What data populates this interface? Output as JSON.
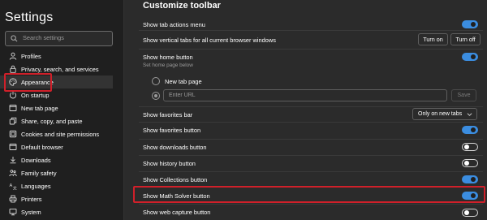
{
  "colors": {
    "sidebar_bg": "#1f1f1f",
    "content_bg": "#2b2b2b",
    "accent": "#3b8de0",
    "highlight": "#d0202a"
  },
  "sidebar": {
    "title": "Settings",
    "search": {
      "placeholder": "Search settings",
      "icon": "search-icon"
    },
    "items": [
      {
        "label": "Profiles",
        "icon": "profile-icon"
      },
      {
        "label": "Privacy, search, and services",
        "icon": "lock-icon"
      },
      {
        "label": "Appearance",
        "icon": "palette-icon",
        "selected": true
      },
      {
        "label": "On startup",
        "icon": "power-icon"
      },
      {
        "label": "New tab page",
        "icon": "new-tab-icon"
      },
      {
        "label": "Share, copy, and paste",
        "icon": "share-icon"
      },
      {
        "label": "Cookies and site permissions",
        "icon": "cookies-icon"
      },
      {
        "label": "Default browser",
        "icon": "browser-icon"
      },
      {
        "label": "Downloads",
        "icon": "download-icon"
      },
      {
        "label": "Family safety",
        "icon": "family-icon"
      },
      {
        "label": "Languages",
        "icon": "languages-icon"
      },
      {
        "label": "Printers",
        "icon": "printer-icon"
      },
      {
        "label": "System",
        "icon": "system-icon"
      }
    ]
  },
  "main": {
    "section_title": "Customize toolbar",
    "rows": {
      "tab_actions": {
        "label": "Show tab actions menu",
        "toggle": true
      },
      "vertical_tabs": {
        "label": "Show vertical tabs for all current browser windows",
        "turn_on": "Turn on",
        "turn_off": "Turn off"
      },
      "home_button": {
        "label": "Show home button",
        "sublabel": "Set home page below",
        "toggle": true,
        "option_new_tab": "New tab page",
        "url_placeholder": "Enter URL",
        "save": "Save"
      },
      "favorites_bar": {
        "label": "Show favorites bar",
        "dropdown_value": "Only on new tabs"
      },
      "favorites_button": {
        "label": "Show favorites button",
        "toggle": true
      },
      "downloads_button": {
        "label": "Show downloads button",
        "toggle": false
      },
      "history_button": {
        "label": "Show history button",
        "toggle": false
      },
      "collections_button": {
        "label": "Show Collections button",
        "toggle": true
      },
      "math_solver_button": {
        "label": "Show Math Solver button",
        "toggle": true
      },
      "web_capture_button": {
        "label": "Show web capture button",
        "toggle": false
      }
    }
  }
}
